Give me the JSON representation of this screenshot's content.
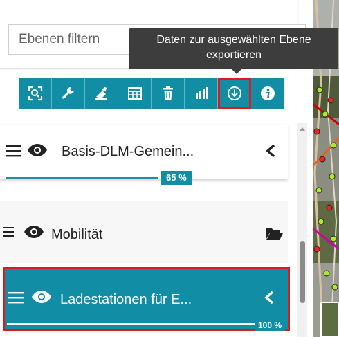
{
  "filter": {
    "placeholder": "Ebenen filtern"
  },
  "tooltip": {
    "line1": "Daten zur ausgewählten Ebene",
    "line2": "exportieren"
  },
  "toolbar": {
    "buttons": [
      {
        "icon": "zoom-to-extent-icon"
      },
      {
        "icon": "wrench-icon"
      },
      {
        "icon": "eraser-icon"
      },
      {
        "icon": "table-icon"
      },
      {
        "icon": "trash-icon"
      },
      {
        "icon": "bar-chart-icon"
      },
      {
        "icon": "download-circle-icon"
      },
      {
        "icon": "info-icon"
      }
    ]
  },
  "layers": [
    {
      "title": "Basis-DLM-Gemein...",
      "progress_label": "65 %",
      "progress": 0.65,
      "state": "expanded"
    },
    {
      "title": "Mobilität",
      "state": "folder"
    },
    {
      "title": "Ladestationen für E...",
      "progress_label": "100 %",
      "progress": 1.0,
      "state": "selected"
    }
  ],
  "colors": {
    "accent": "#118ea5",
    "highlight": "#e4171d",
    "tooltip_bg": "#3d3d3d"
  }
}
